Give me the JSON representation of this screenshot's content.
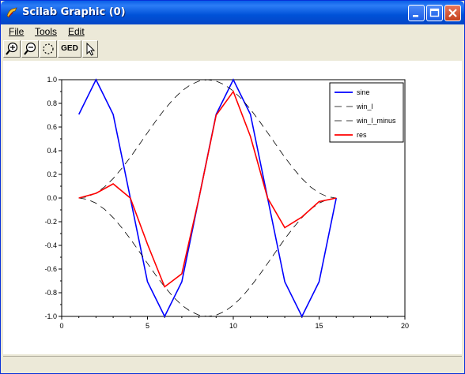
{
  "window": {
    "title": "Scilab Graphic (0)"
  },
  "menu": {
    "file": "File",
    "tools": "Tools",
    "edit": "Edit"
  },
  "toolbar": {
    "ged_label": "GED"
  },
  "chart_data": {
    "type": "line",
    "xlim": [
      0,
      20
    ],
    "ylim": [
      -1.0,
      1.0
    ],
    "x_ticks": [
      "0",
      "5",
      "10",
      "15",
      "20"
    ],
    "y_ticks": [
      "-1.0",
      "-0.8",
      "-0.6",
      "-0.4",
      "-0.2",
      "0.0",
      "0.2",
      "0.4",
      "0.6",
      "0.8",
      "1.0"
    ],
    "grid": false,
    "legend_position": "top-right",
    "series": [
      {
        "name": "sine",
        "color": "#0000ff",
        "style": "solid",
        "x": [
          1,
          2,
          3,
          4,
          5,
          6,
          7,
          8,
          9,
          10,
          11,
          12,
          13,
          14,
          15,
          16
        ],
        "y": [
          0.707,
          1.0,
          0.707,
          0.0,
          -0.707,
          -1.0,
          -0.707,
          0.0,
          0.707,
          1.0,
          0.707,
          0.0,
          -0.707,
          -1.0,
          -0.707,
          0.0
        ]
      },
      {
        "name": "win_l",
        "color": "#000000",
        "style": "dashed",
        "x": [
          1,
          1.5,
          2,
          2.5,
          3,
          3.5,
          4,
          4.5,
          5,
          5.5,
          6,
          6.5,
          7,
          7.5,
          8,
          8.5,
          9,
          9.5,
          10,
          10.5,
          11,
          11.5,
          12,
          12.5,
          13,
          13.5,
          14,
          14.5,
          15,
          15.5,
          16
        ],
        "y": [
          0.0,
          0.011,
          0.043,
          0.095,
          0.165,
          0.25,
          0.345,
          0.448,
          0.552,
          0.655,
          0.75,
          0.835,
          0.905,
          0.957,
          0.989,
          1.0,
          0.989,
          0.957,
          0.905,
          0.835,
          0.75,
          0.655,
          0.552,
          0.448,
          0.345,
          0.25,
          0.165,
          0.095,
          0.043,
          0.011,
          0.0
        ]
      },
      {
        "name": "win_l_minus",
        "color": "#000000",
        "style": "dashed",
        "x": [
          1,
          1.5,
          2,
          2.5,
          3,
          3.5,
          4,
          4.5,
          5,
          5.5,
          6,
          6.5,
          7,
          7.5,
          8,
          8.5,
          9,
          9.5,
          10,
          10.5,
          11,
          11.5,
          12,
          12.5,
          13,
          13.5,
          14,
          14.5,
          15,
          15.5,
          16
        ],
        "y": [
          0.0,
          -0.011,
          -0.043,
          -0.095,
          -0.165,
          -0.25,
          -0.345,
          -0.448,
          -0.552,
          -0.655,
          -0.75,
          -0.835,
          -0.905,
          -0.957,
          -0.989,
          -1.0,
          -0.989,
          -0.957,
          -0.905,
          -0.835,
          -0.75,
          -0.655,
          -0.552,
          -0.448,
          -0.345,
          -0.25,
          -0.165,
          -0.095,
          -0.043,
          -0.011,
          0.0
        ]
      },
      {
        "name": "res",
        "color": "#ff0000",
        "style": "solid",
        "x": [
          1,
          2,
          3,
          4,
          5,
          6,
          7,
          8,
          9,
          10,
          11,
          12,
          13,
          14,
          15,
          16
        ],
        "y": [
          0.0,
          0.04,
          0.12,
          0.0,
          -0.39,
          -0.75,
          -0.64,
          0.0,
          0.7,
          0.9,
          0.52,
          0.0,
          -0.25,
          -0.16,
          -0.03,
          0.0
        ]
      }
    ]
  }
}
